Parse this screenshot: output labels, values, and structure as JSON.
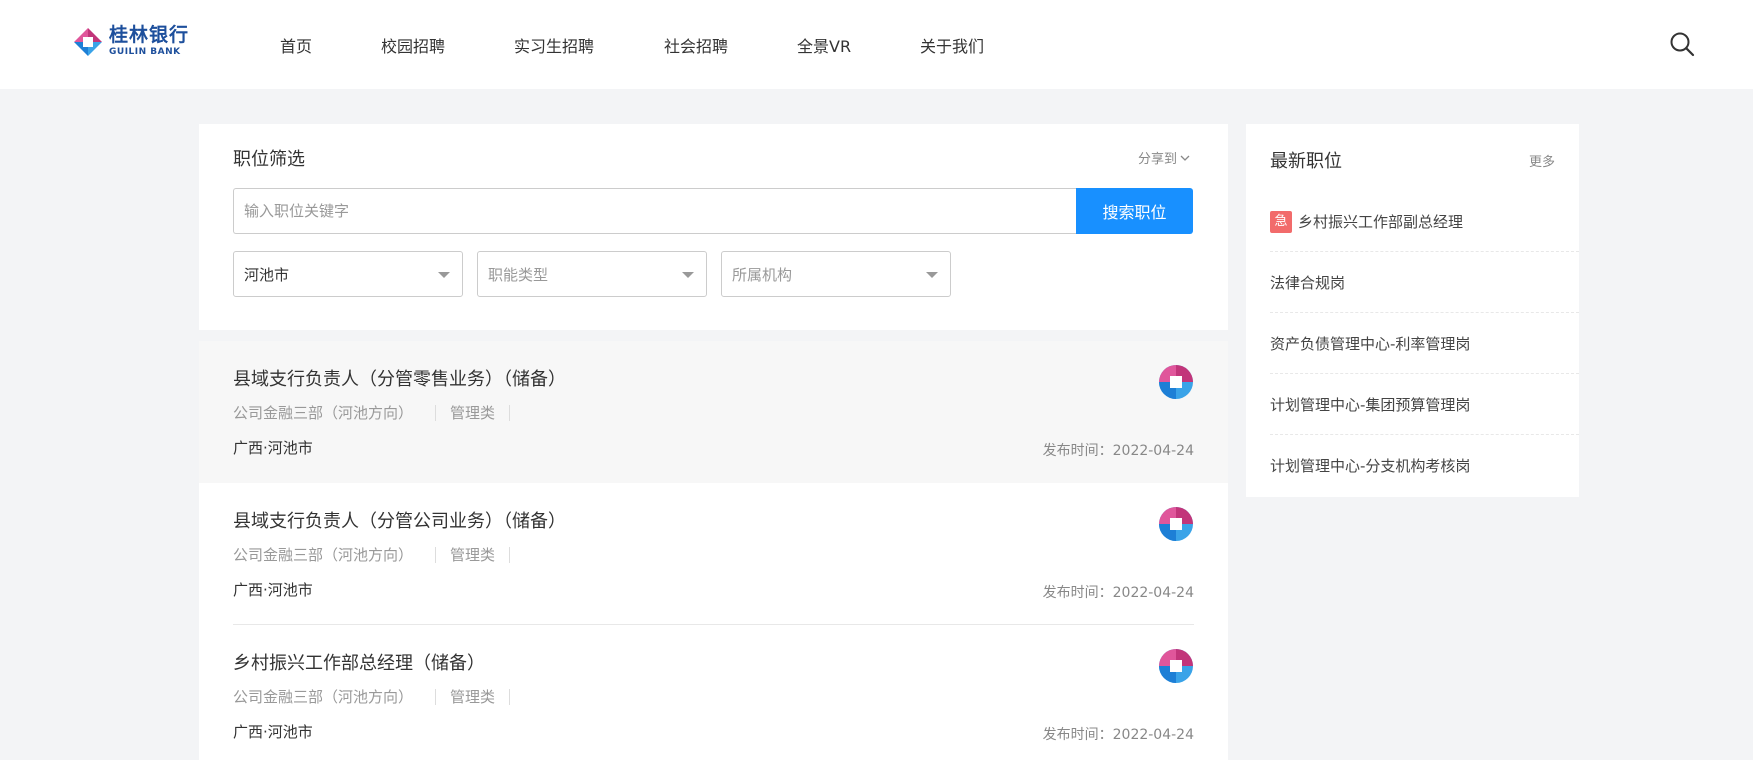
{
  "brand": {
    "name_cn": "桂林银行",
    "name_en": "GUILIN BANK"
  },
  "nav": {
    "items": [
      {
        "label": "首页"
      },
      {
        "label": "校园招聘"
      },
      {
        "label": "实习生招聘"
      },
      {
        "label": "社会招聘"
      },
      {
        "label": "全景VR"
      },
      {
        "label": "关于我们"
      }
    ],
    "search_icon": "search-icon"
  },
  "filter": {
    "title": "职位筛选",
    "share_label": "分享到",
    "search_placeholder": "输入职位关键字",
    "search_value": "",
    "search_button": "搜索职位",
    "selects": {
      "city": "河池市",
      "function_type": "职能类型",
      "organization": "所属机构"
    }
  },
  "jobs": [
    {
      "title": "县域支行负责人（分管零售业务）（储备）",
      "department": "公司金融三部（河池方向）",
      "category": "管理类",
      "location": "广西·河池市",
      "date": "发布时间：2022-04-24"
    },
    {
      "title": "县域支行负责人（分管公司业务）（储备）",
      "department": "公司金融三部（河池方向）",
      "category": "管理类",
      "location": "广西·河池市",
      "date": "发布时间：2022-04-24"
    },
    {
      "title": "乡村振兴工作部总经理（储备）",
      "department": "公司金融三部（河池方向）",
      "category": "管理类",
      "location": "广西·河池市",
      "date": "发布时间：2022-04-24"
    }
  ],
  "latest": {
    "title": "最新职位",
    "more": "更多",
    "urgent_badge": "急",
    "items": [
      {
        "label": "乡村振兴工作部副总经理"
      },
      {
        "label": "法律合规岗"
      },
      {
        "label": "资产负债管理中心-利率管理岗"
      },
      {
        "label": "计划管理中心-集团预算管理岗"
      },
      {
        "label": "计划管理中心-分支机构考核岗"
      }
    ]
  },
  "colors": {
    "accent": "#1890ff",
    "brand_blue": "#1d4f9c",
    "brand_magenta": "#c2357a",
    "urgent": "#f26b6b"
  }
}
